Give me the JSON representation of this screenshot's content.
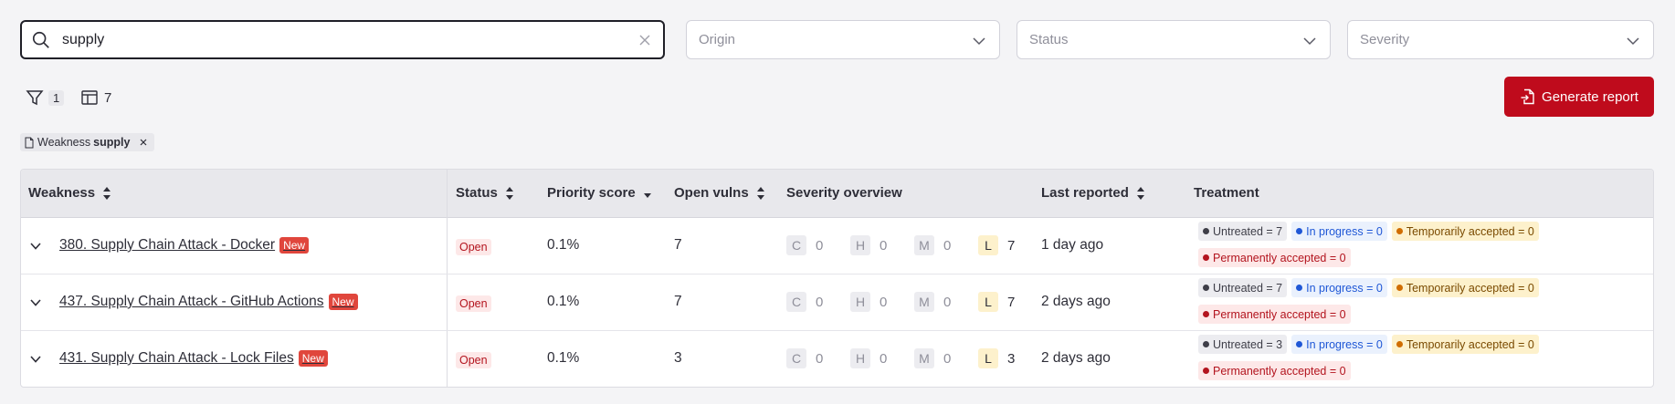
{
  "search": {
    "value": "supply",
    "placeholder": ""
  },
  "filters": {
    "origin": "Origin",
    "status": "Status",
    "severity": "Severity"
  },
  "toolbar": {
    "filter_count": "1",
    "columns_count": "7",
    "generate_report": "Generate report"
  },
  "chip": {
    "label": "Weakness",
    "value": "supply"
  },
  "table": {
    "headers": {
      "weakness": "Weakness",
      "status": "Status",
      "priority": "Priority score",
      "open_vulns": "Open vulns",
      "severity": "Severity overview",
      "last_reported": "Last reported",
      "treatment": "Treatment"
    },
    "severity_letters": {
      "c": "C",
      "h": "H",
      "m": "M",
      "l": "L"
    },
    "rows": [
      {
        "weakness": "380. Supply Chain Attack - Docker",
        "badge": "New",
        "status": "Open",
        "priority": "0.1%",
        "open_vulns": "7",
        "sev_c": "0",
        "sev_h": "0",
        "sev_m": "0",
        "sev_l": "7",
        "last_reported": "1 day ago",
        "untreated": "Untreated = 7",
        "in_progress": "In progress = 0",
        "temp_accepted": "Temporarily accepted = 0",
        "perm_accepted": "Permanently accepted = 0"
      },
      {
        "weakness": "437. Supply Chain Attack - GitHub Actions",
        "badge": "New",
        "status": "Open",
        "priority": "0.1%",
        "open_vulns": "7",
        "sev_c": "0",
        "sev_h": "0",
        "sev_m": "0",
        "sev_l": "7",
        "last_reported": "2 days ago",
        "untreated": "Untreated = 7",
        "in_progress": "In progress = 0",
        "temp_accepted": "Temporarily accepted = 0",
        "perm_accepted": "Permanently accepted = 0"
      },
      {
        "weakness": "431. Supply Chain Attack - Lock Files",
        "badge": "New",
        "status": "Open",
        "priority": "0.1%",
        "open_vulns": "3",
        "sev_c": "0",
        "sev_h": "0",
        "sev_m": "0",
        "sev_l": "3",
        "last_reported": "2 days ago",
        "untreated": "Untreated = 3",
        "in_progress": "In progress = 0",
        "temp_accepted": "Temporarily accepted = 0",
        "perm_accepted": "Permanently accepted = 0"
      }
    ]
  }
}
